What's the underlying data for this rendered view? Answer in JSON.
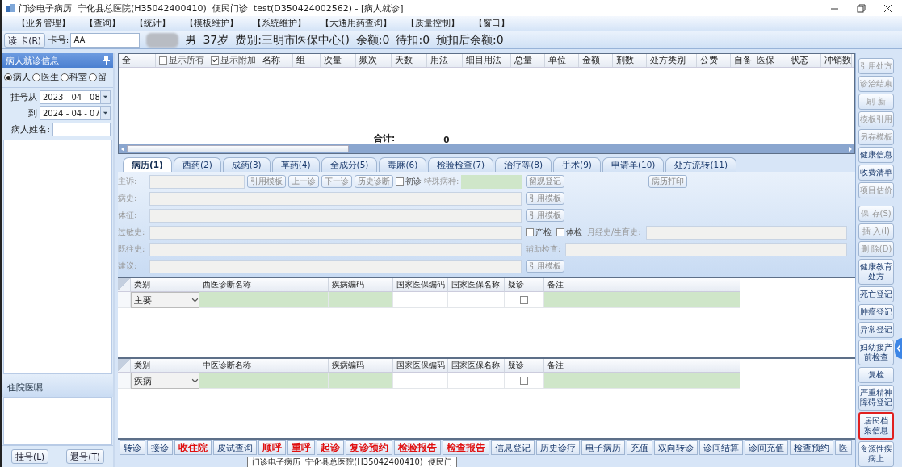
{
  "window": {
    "title": "门诊电子病历  宁化县总医院(H35042400410)  便民门诊  test(D350424002562) - [病人就诊]"
  },
  "menu": [
    "【业务管理】",
    "【查询】",
    "【统计】",
    "【模板维护】",
    "【系统维护】",
    "【大通用药查询】",
    "【质量控制】",
    "【窗口】"
  ],
  "patient_bar": {
    "read_card": "读 卡(R)",
    "card_label": "卡号:",
    "card_value": "AA",
    "info": [
      "男",
      "37岁",
      "费别:三明市医保中心()",
      "余额:0",
      "待扣:0",
      "预扣后余额:0"
    ]
  },
  "left_panel": {
    "title": "病人就诊信息",
    "radios": [
      {
        "label": "病人",
        "selected": true
      },
      {
        "label": "医生",
        "selected": false
      },
      {
        "label": "科室",
        "selected": false
      },
      {
        "label": "留",
        "selected": false
      }
    ],
    "date_from_label": "挂号从",
    "date_from": "2023 - 04 - 08",
    "date_to_label": "到",
    "date_to": "2024 - 04 - 07",
    "name_label": "病人姓名:",
    "orders_title": "住院医嘱",
    "buttons": [
      "挂号(L)",
      "退号(T)"
    ]
  },
  "prescription_grid": {
    "select_all": "全",
    "show_all": {
      "label": "显示所有",
      "checked": false
    },
    "show_extra": {
      "label": "显示附加",
      "checked": true
    },
    "columns": [
      "名称",
      "组",
      "次量",
      "频次",
      "天数",
      "用法",
      "细目用法",
      "总量",
      "单位",
      "金额",
      "剂数",
      "处方类别",
      "公费",
      "自备",
      "医保",
      "状态",
      "冲销数"
    ],
    "total_label": "合计:",
    "total_value": "0"
  },
  "tabs": [
    {
      "label": "病历(1)",
      "selected": true
    },
    {
      "label": "西药(2)",
      "selected": false
    },
    {
      "label": "成药(3)",
      "selected": false
    },
    {
      "label": "草药(4)",
      "selected": false
    },
    {
      "label": "全成分(5)",
      "selected": false
    },
    {
      "label": "毒麻(6)",
      "selected": false
    },
    {
      "label": "检验检查(7)",
      "selected": false
    },
    {
      "label": "治疗等(8)",
      "selected": false
    },
    {
      "label": "手术(9)",
      "selected": false
    },
    {
      "label": "申请单(10)",
      "selected": false
    },
    {
      "label": "处方流转(11)",
      "selected": false
    }
  ],
  "record_form": [
    {
      "label": "主诉:",
      "kind": "short",
      "inline": [
        {
          "kind": "button",
          "text": "引用模板"
        },
        {
          "kind": "button",
          "text": "上一诊"
        },
        {
          "kind": "button",
          "text": "下一诊"
        },
        {
          "kind": "button",
          "text": "历史诊断"
        },
        {
          "kind": "checkbox",
          "text": "初诊",
          "checked": false
        },
        {
          "kind": "label",
          "text": "特殊病种:"
        },
        {
          "kind": "green_field"
        }
      ],
      "side": [
        {
          "kind": "button",
          "text": "留观登记"
        },
        {
          "kind": "button",
          "text": "病历打印"
        }
      ]
    },
    {
      "label": "病史:",
      "kind": "long",
      "side": [
        {
          "kind": "button",
          "text": "引用模板"
        }
      ]
    },
    {
      "label": "体征:",
      "kind": "long",
      "side": [
        {
          "kind": "button",
          "text": "引用模板"
        }
      ]
    },
    {
      "label": "过敏史:",
      "kind": "long",
      "side": [
        {
          "kind": "checkbox",
          "text": "产检",
          "checked": false
        },
        {
          "kind": "checkbox",
          "text": "体检",
          "checked": false
        },
        {
          "kind": "label",
          "text": "月经史/生育史:"
        },
        {
          "kind": "field"
        }
      ]
    },
    {
      "label": "既往史:",
      "kind": "long",
      "side": [
        {
          "kind": "label",
          "text": "辅助检查:"
        },
        {
          "kind": "field"
        }
      ]
    },
    {
      "label": "建议:",
      "kind": "long",
      "side": [
        {
          "kind": "button",
          "text": "引用模板"
        }
      ]
    }
  ],
  "western_diagnosis": {
    "columns": [
      "类别",
      "西医诊断名称",
      "疾病编码",
      "国家医保编码",
      "国家医保名称",
      "疑诊",
      "备注"
    ],
    "rows": [
      {
        "category": "主要",
        "suspected": false
      }
    ]
  },
  "tcm_diagnosis": {
    "columns": [
      "类别",
      "中医诊断名称",
      "疾病编码",
      "国家医保编码",
      "国家医保名称",
      "疑诊",
      "备注"
    ],
    "rows": [
      {
        "category": "疾病",
        "suspected": false
      }
    ]
  },
  "bottom_buttons": [
    {
      "label": "转诊",
      "emphasis": false
    },
    {
      "label": "接诊",
      "emphasis": false
    },
    {
      "label": "收住院",
      "emphasis": true
    },
    {
      "label": "皮试查询",
      "emphasis": false
    },
    {
      "label": "顺呼",
      "emphasis": true
    },
    {
      "label": "重呼",
      "emphasis": true
    },
    {
      "label": "起诊",
      "emphasis": true
    },
    {
      "label": "复诊预约",
      "emphasis": true
    },
    {
      "label": "检验报告",
      "emphasis": true
    },
    {
      "label": "检查报告",
      "emphasis": true
    },
    {
      "label": "信息登记",
      "emphasis": false
    },
    {
      "label": "历史诊疗",
      "emphasis": false
    },
    {
      "label": "电子病历",
      "emphasis": false
    },
    {
      "label": "充值",
      "emphasis": false
    },
    {
      "label": "双向转诊",
      "emphasis": false
    },
    {
      "label": "诊间结算",
      "emphasis": false
    },
    {
      "label": "诊间充值",
      "emphasis": false
    },
    {
      "label": "检查预约",
      "emphasis": false
    },
    {
      "label": "医",
      "emphasis": false
    }
  ],
  "side_buttons_top": [
    {
      "label": "引用处方",
      "disabled": true
    },
    {
      "label": "诊治结束",
      "disabled": true
    },
    {
      "label": "刷 新",
      "disabled": true
    },
    {
      "label": "模板引用",
      "disabled": true
    },
    {
      "label": "另存模板",
      "disabled": true
    },
    {
      "label": "健康信息",
      "disabled": false
    },
    {
      "label": "收费清单",
      "disabled": false
    },
    {
      "label": "项目估价",
      "disabled": true
    }
  ],
  "side_buttons_bottom": [
    {
      "label": "保 存(S)",
      "disabled": true,
      "highlighted": false
    },
    {
      "label": "插 入(I)",
      "disabled": true,
      "highlighted": false
    },
    {
      "label": "删 除(D)",
      "disabled": true,
      "highlighted": false
    },
    {
      "label": "健康教育处方",
      "disabled": false,
      "highlighted": false
    },
    {
      "label": "死亡登记",
      "disabled": false,
      "highlighted": false
    },
    {
      "label": "肿瘤登记",
      "disabled": false,
      "highlighted": false
    },
    {
      "label": "异常登记",
      "disabled": false,
      "highlighted": false
    },
    {
      "label": "妇幼接产前检查",
      "disabled": false,
      "highlighted": false
    },
    {
      "label": "复检",
      "disabled": false,
      "highlighted": false
    },
    {
      "label": "严重精神障碍登记",
      "disabled": false,
      "highlighted": false
    },
    {
      "label": "居民档案信息",
      "disabled": false,
      "highlighted": true
    },
    {
      "label": "食源性疾病上",
      "disabled": false,
      "highlighted": false
    }
  ],
  "tooltip": "门诊电子病历  宁化县总医院(H35042400410)  便民门"
}
